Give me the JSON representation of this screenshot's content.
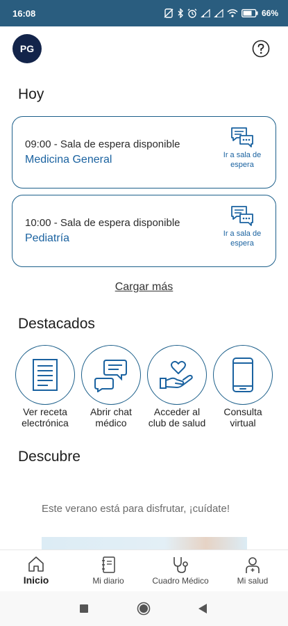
{
  "status_bar": {
    "time": "16:08",
    "battery": "66%",
    "icons": [
      "no-sim-icon",
      "bluetooth-icon",
      "alarm-icon",
      "signal-icon",
      "signal-icon",
      "wifi-icon",
      "battery-icon"
    ]
  },
  "header": {
    "avatar_initials": "PG",
    "help_icon": "help-circle-icon"
  },
  "today": {
    "title": "Hoy",
    "appointments": [
      {
        "line1": "09:00 - Sala de espera disponible",
        "specialty": "Medicina General",
        "action_label": "Ir a sala de espera",
        "icon": "chat-bubbles-icon"
      },
      {
        "line1": "10:00 - Sala de espera disponible",
        "specialty": "Pediatría",
        "action_label": "Ir a sala de espera",
        "icon": "chat-bubbles-icon"
      }
    ],
    "load_more": "Cargar más"
  },
  "highlights": {
    "title": "Destacados",
    "items": [
      {
        "label": "Ver receta electrónica",
        "icon": "document-icon"
      },
      {
        "label": "Abrir chat médico",
        "icon": "chat-icon"
      },
      {
        "label": "Acceder al club de salud",
        "icon": "heart-hand-icon"
      },
      {
        "label": "Consulta virtual",
        "icon": "smartphone-icon"
      }
    ]
  },
  "discover": {
    "title": "Descubre",
    "promo_text": "Este verano está para disfrutar, ¡cuídate!"
  },
  "bottom_nav": {
    "items": [
      {
        "label": "Inicio",
        "icon": "home-icon",
        "active": true
      },
      {
        "label": "Mi diario",
        "icon": "notebook-icon",
        "active": false
      },
      {
        "label": "Cuadro Médico",
        "icon": "stethoscope-icon",
        "active": false
      },
      {
        "label": "Mi salud",
        "icon": "person-icon",
        "active": false
      }
    ]
  },
  "system_nav": [
    "recents-button",
    "home-button",
    "back-button"
  ],
  "colors": {
    "status_bar": "#2a5d7f",
    "accent_blue": "#1a62a0",
    "outline_blue": "#1c5f8a",
    "avatar": "#13244a"
  }
}
